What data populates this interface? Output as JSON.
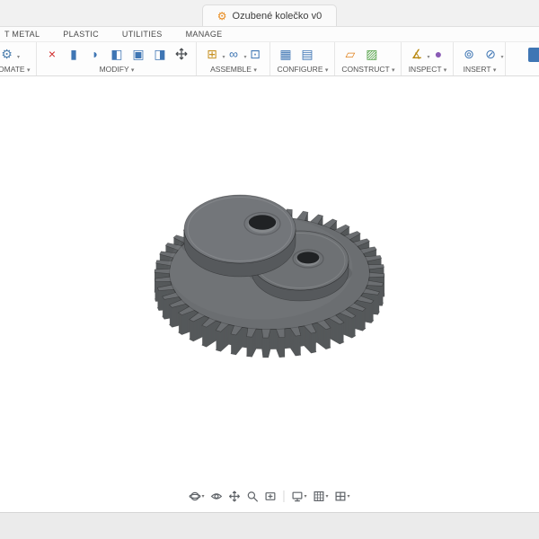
{
  "titlebar": {
    "document_title": "Ozubené kolečko v0",
    "document_icon": "gear-document-icon"
  },
  "ribbon_tabs": [
    {
      "label": "T METAL"
    },
    {
      "label": "PLASTIC"
    },
    {
      "label": "UTILITIES"
    },
    {
      "label": "MANAGE"
    }
  ],
  "toolbar_groups": [
    {
      "label": "OMATE",
      "cropped": true,
      "icons": [
        {
          "name": "automate-icon",
          "glyph": "⚙",
          "color": "#4d7fae",
          "caret": true
        }
      ]
    },
    {
      "label": "MODIFY",
      "icons": [
        {
          "name": "delete-icon",
          "glyph": "×",
          "color": "#d02b2b"
        },
        {
          "name": "press-pull-icon",
          "glyph": "▮",
          "color": "#3f76b4"
        },
        {
          "name": "fillet-icon",
          "glyph": "◗",
          "color": "#3f76b4"
        },
        {
          "name": "shell-icon",
          "glyph": "◧",
          "color": "#3f76b4"
        },
        {
          "name": "combine-icon",
          "glyph": "▣",
          "color": "#3f76b4"
        },
        {
          "name": "offset-face-icon",
          "glyph": "◨",
          "color": "#3f76b4"
        },
        {
          "name": "move-copy-icon",
          "glyph": "svg:pan",
          "color": "#4a4e52"
        }
      ]
    },
    {
      "label": "ASSEMBLE",
      "icons": [
        {
          "name": "new-component-icon",
          "glyph": "⊞",
          "color": "#c79121",
          "caret": true
        },
        {
          "name": "joint-icon",
          "glyph": "∞",
          "color": "#3f76b4",
          "caret": true
        },
        {
          "name": "as-built-joint-icon",
          "glyph": "⊡",
          "color": "#3f76b4"
        }
      ]
    },
    {
      "label": "CONFIGURE",
      "icons": [
        {
          "name": "configuration-table-icon",
          "glyph": "▦",
          "color": "#3f76b4"
        },
        {
          "name": "configure-features-icon",
          "glyph": "▤",
          "color": "#3f76b4"
        }
      ]
    },
    {
      "label": "CONSTRUCT",
      "icons": [
        {
          "name": "construct-plane-icon",
          "glyph": "▱",
          "color": "#e0821e"
        },
        {
          "name": "construct-axis-icon",
          "glyph": "▨",
          "color": "#58a44c"
        }
      ]
    },
    {
      "label": "INSPECT",
      "icons": [
        {
          "name": "measure-icon",
          "glyph": "∡",
          "color": "#b8860b",
          "caret": true
        },
        {
          "name": "section-analysis-icon",
          "glyph": "●",
          "color": "#8a5bb5"
        }
      ]
    },
    {
      "label": "INSERT",
      "icons": [
        {
          "name": "insert-derive-icon",
          "glyph": "⊚",
          "color": "#3f76b4"
        },
        {
          "name": "insert-mesh-icon",
          "glyph": "⊘",
          "color": "#3f76b4",
          "caret": true
        }
      ]
    }
  ],
  "toolbar_cropped_icon": {
    "name": "cropped-partial-icon",
    "color": "#3f76b4"
  },
  "navbar": {
    "items": [
      {
        "name": "orbit",
        "caret": true
      },
      {
        "name": "look-at",
        "caret": false
      },
      {
        "name": "pan",
        "caret": false
      },
      {
        "name": "zoom",
        "caret": false
      },
      {
        "name": "fit",
        "caret": false
      },
      {
        "name": "display-settings",
        "caret": true,
        "sep_before": true
      },
      {
        "name": "grid-and-snaps",
        "caret": true
      },
      {
        "name": "viewports",
        "caret": true
      }
    ]
  },
  "model": {
    "description": "3D spur gear with two stacked cylindrical discs, each with a hole",
    "colors": {
      "gear_top": "#6b6e71",
      "gear_side": "#55585a",
      "gear_bottom": "#44474a",
      "disc_top_right": "#6e7174",
      "disc_top_left": "#73767a",
      "disc_side": "#56595c",
      "hole_wall": "#85888b",
      "hole_dark": "#202224"
    }
  }
}
